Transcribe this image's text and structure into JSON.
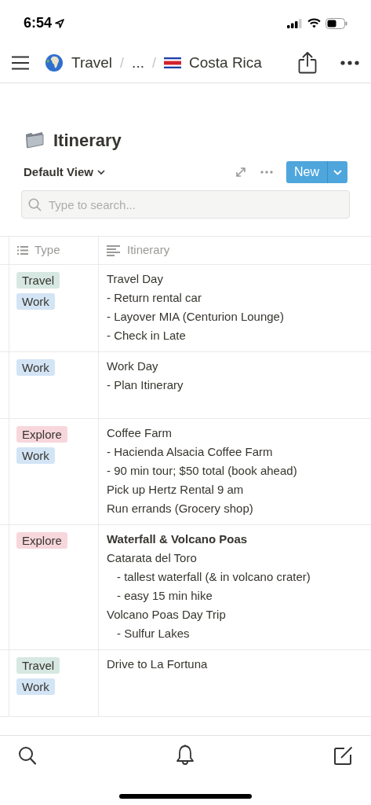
{
  "status_bar": {
    "time": "6:54"
  },
  "nav": {
    "breadcrumbs": [
      "Travel",
      "...",
      "Costa Rica"
    ],
    "separator": "/"
  },
  "page": {
    "title": "Itinerary",
    "view": "Default View",
    "new_button": "New",
    "search": {
      "placeholder": "Type to search..."
    }
  },
  "table": {
    "columns": [
      "Type",
      "Itinerary"
    ],
    "rows": [
      {
        "tags": [
          {
            "label": "Travel",
            "color": "#d7e8e2"
          },
          {
            "label": "Work",
            "color": "#d3e4f5"
          }
        ],
        "lines": [
          {
            "text": "Travel Day",
            "bold": false
          },
          {
            "text": "- Return rental car",
            "bold": false
          },
          {
            "text": "- Layover MIA (Centurion Lounge)",
            "bold": false
          },
          {
            "text": "- Check in Late",
            "bold": false
          }
        ]
      },
      {
        "tags": [
          {
            "label": "Work",
            "color": "#d3e4f5"
          }
        ],
        "lines": [
          {
            "text": "Work Day",
            "bold": false
          },
          {
            "text": "- Plan Itinerary",
            "bold": false
          }
        ]
      },
      {
        "tags": [
          {
            "label": "Explore",
            "color": "#f7d7dc"
          },
          {
            "label": "Work",
            "color": "#d3e4f5"
          }
        ],
        "lines": [
          {
            "text": "Coffee Farm",
            "bold": false
          },
          {
            "text": "- Hacienda Alsacia Coffee Farm",
            "bold": false
          },
          {
            "text": "- 90 min tour; $50 total (book ahead)",
            "bold": false
          },
          {
            "text": "Pick up Hertz Rental 9 am",
            "bold": false
          },
          {
            "text": "Run errands (Grocery shop)",
            "bold": false
          }
        ]
      },
      {
        "tags": [
          {
            "label": "Explore",
            "color": "#f7d7dc"
          }
        ],
        "lines": [
          {
            "text": "Waterfall & Volcano Poas",
            "bold": true
          },
          {
            "text": "Catarata del Toro",
            "bold": false,
            "children": [
              {
                "text": "- tallest waterfall (& in volcano crater)",
                "bold": false
              },
              {
                "text": "- easy 15 min hike",
                "bold": false
              }
            ]
          },
          {
            "text": "Volcano Poas Day Trip",
            "bold": false,
            "children": [
              {
                "text": "- Sulfur Lakes",
                "bold": false
              }
            ]
          }
        ]
      },
      {
        "tags": [
          {
            "label": "Travel",
            "color": "#d7e8e2"
          },
          {
            "label": "Work",
            "color": "#d3e4f5"
          }
        ],
        "lines": [
          {
            "text": "Drive to La Fortuna",
            "bold": false
          }
        ]
      }
    ]
  }
}
